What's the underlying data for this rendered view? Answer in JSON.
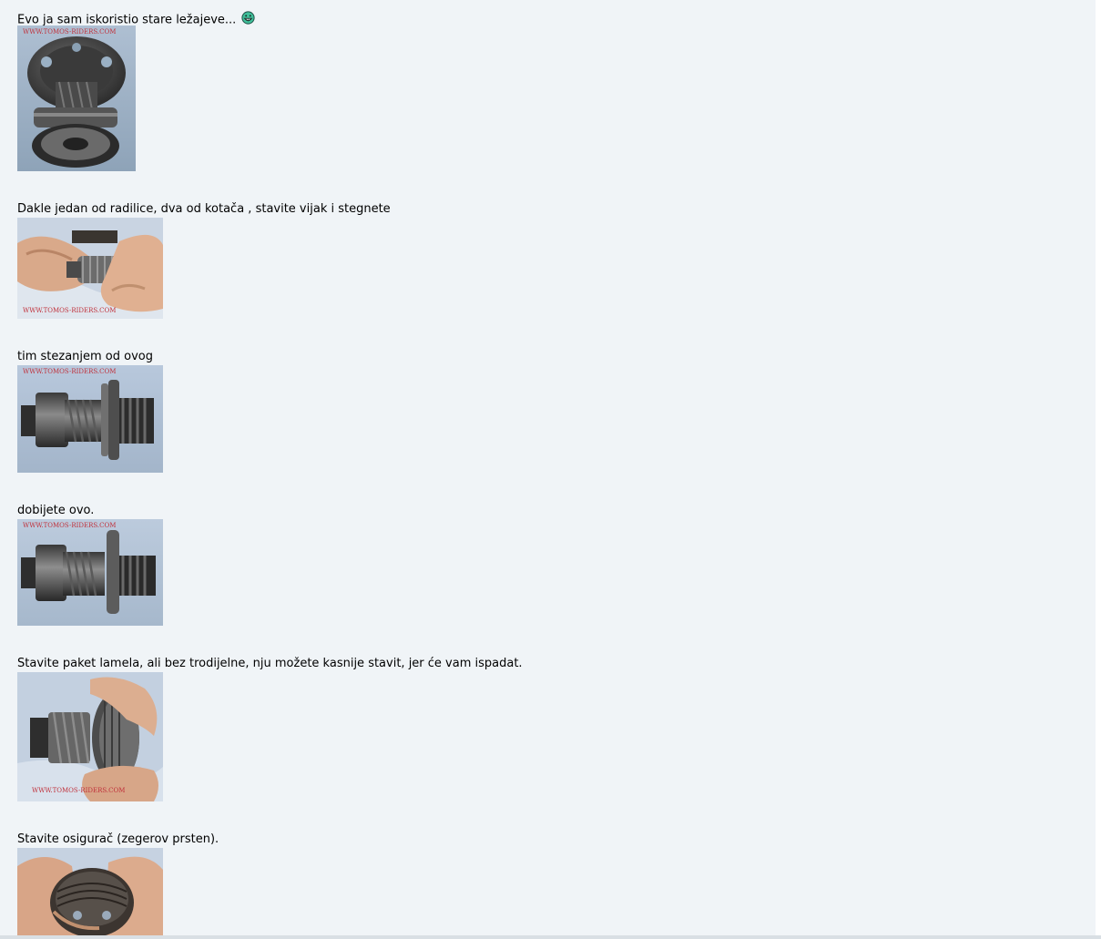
{
  "post": {
    "blocks": [
      {
        "text": "Evo ja sam iskoristio stare ležajeve...",
        "emoticon": "grin-smiley-icon",
        "image": "bearings-on-pinion-photo",
        "watermark": "WWW.TOMOS-RIDERS.COM"
      },
      {
        "text": "Dakle jedan od radilice, dva od kotača , stavite vijak i stegnete",
        "image": "hands-tightening-screw-photo",
        "watermark": "WWW.TOMOS-RIDERS.COM"
      },
      {
        "text": "tim stezanjem od ovog",
        "image": "gear-assembly-before-photo",
        "watermark": "WWW.TOMOS-RIDERS.COM"
      },
      {
        "text": "dobijete ovo.",
        "image": "gear-assembly-after-photo",
        "watermark": "WWW.TOMOS-RIDERS.COM"
      },
      {
        "text": "Stavite paket lamela, ali bez trodijelne, nju možete kasnije stavit, jer će vam ispadat.",
        "image": "hands-placing-clutch-plates-photo",
        "watermark": "WWW.TOMOS-RIDERS.COM"
      },
      {
        "text": "Stavite osigurač (zegerov prsten).",
        "image": "hands-holding-clutch-photo",
        "watermark": ""
      }
    ]
  }
}
